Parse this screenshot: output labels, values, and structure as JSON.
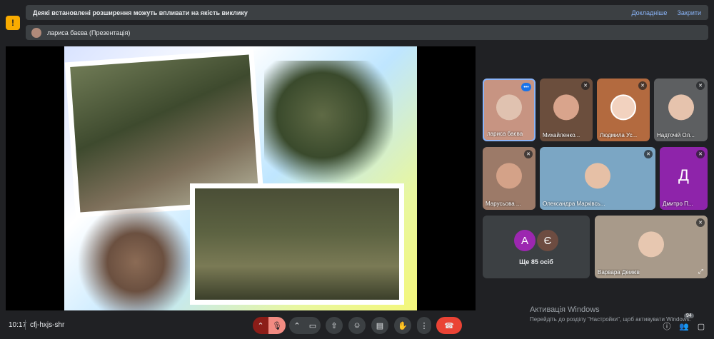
{
  "banner": {
    "text": "Деякі встановлені розширення можуть впливати на якість виклику",
    "details_link": "Докладніше",
    "close_link": "Закрити"
  },
  "presenter": {
    "label": "лариса баєва (Презентація)"
  },
  "participants": [
    {
      "name": "лариса баєва"
    },
    {
      "name": "Михайленко..."
    },
    {
      "name": "Людмила Ус..."
    },
    {
      "name": "Надточій Ол..."
    },
    {
      "name": "Марусьова ..."
    },
    {
      "name": "Олександра Марківсь..."
    },
    {
      "name": "Дмитро П...",
      "initial": "Д"
    },
    {
      "name": "Варвара Демків"
    }
  ],
  "more_tile": {
    "avatars": [
      "А",
      "Є"
    ],
    "label": "Ще 85 осіб"
  },
  "bottom_bar": {
    "time": "10:17",
    "meeting_code": "cfj-hxjs-shr",
    "participant_count": "94"
  },
  "windows_watermark": {
    "title": "Активація Windows",
    "subtitle": "Перейдіть до розділу \"Настройки\", щоб активувати Windows."
  },
  "colors": {
    "avatar_a": "#9c27b0",
    "avatar_e": "#6d4c41",
    "avatar_d": "#8e24aa",
    "end_call": "#ea4335",
    "mic_off": "#8c1d18"
  },
  "icons": [
    "warning-icon",
    "more-dots-icon",
    "mic-off-icon",
    "camera-icon",
    "present-icon",
    "emoji-icon",
    "captions-icon",
    "raise-hand-icon",
    "more-options-icon",
    "end-call-icon",
    "info-icon",
    "people-icon",
    "chat-icon",
    "pin-icon"
  ]
}
